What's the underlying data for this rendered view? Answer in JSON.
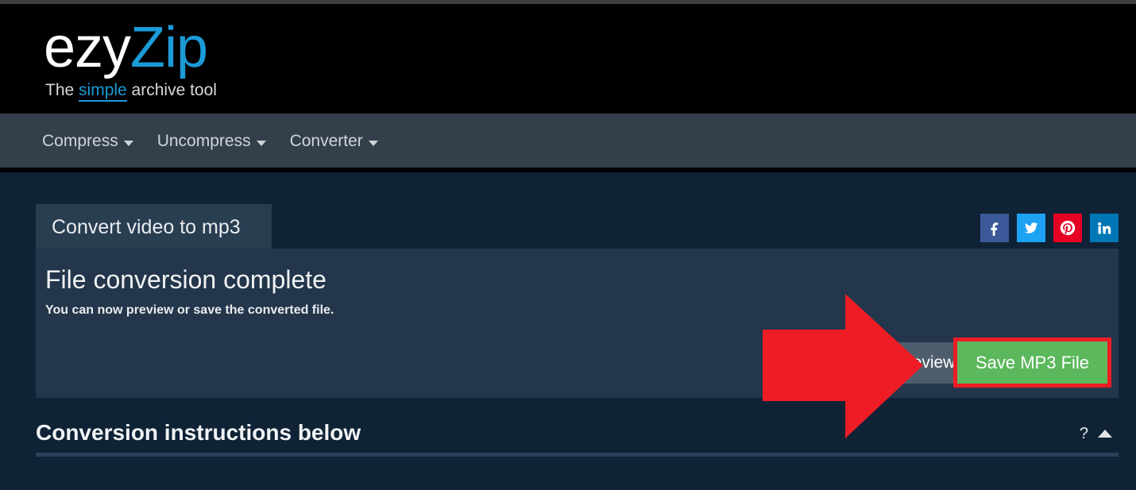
{
  "brand": {
    "logo_primary": "ezy",
    "logo_secondary": "Zip",
    "tagline_before": "The ",
    "tagline_highlight": "simple",
    "tagline_after": " archive tool",
    "logo_primary_color": "#ffffff",
    "logo_secondary_color": "#1b9bd8"
  },
  "nav": {
    "items": [
      {
        "label": "Compress"
      },
      {
        "label": "Uncompress"
      },
      {
        "label": "Converter"
      }
    ]
  },
  "social": {
    "items": [
      {
        "name": "facebook",
        "label": "f",
        "color": "#3b5998"
      },
      {
        "name": "twitter",
        "label": "t",
        "color": "#1da1f2"
      },
      {
        "name": "pinterest",
        "label": "P",
        "color": "#e60023"
      },
      {
        "name": "linkedin",
        "label": "in",
        "color": "#0077b5"
      }
    ]
  },
  "card": {
    "tab_label": "Convert video to mp3",
    "title": "File conversion complete",
    "subtitle": "You can now preview or save the converted file.",
    "preview_button": "Preview",
    "save_button": "Save MP3 File",
    "save_button_color": "#5cb85c",
    "highlight_color": "#ee1c25"
  },
  "annotation": {
    "arrow_color": "#ee1c25",
    "arrow_points_to": "Save MP3 File"
  },
  "instructions": {
    "heading": "Conversion instructions below",
    "help_symbol": "?"
  }
}
